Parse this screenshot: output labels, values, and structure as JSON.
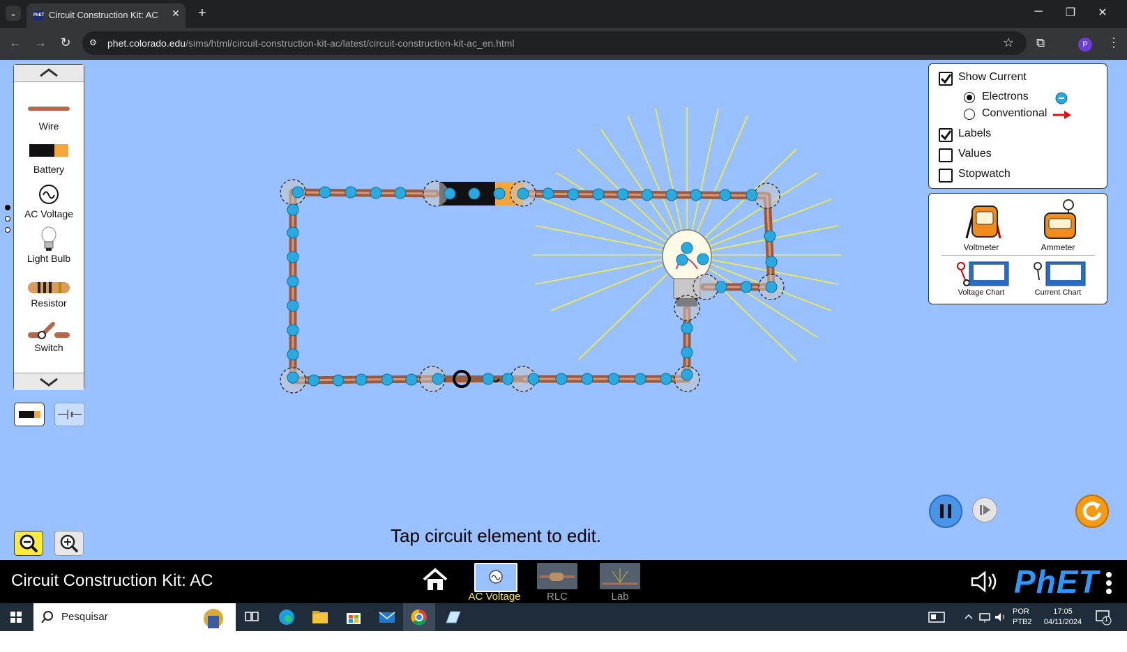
{
  "browser": {
    "tab_title": "Circuit Construction Kit: AC",
    "url_host": "phet.colorado.edu",
    "url_path": "/sims/html/circuit-construction-kit-ac/latest/circuit-construction-kit-ac_en.html"
  },
  "toolbox": {
    "items": [
      {
        "label": "Wire"
      },
      {
        "label": "Battery"
      },
      {
        "label": "AC Voltage"
      },
      {
        "label": "Light Bulb"
      },
      {
        "label": "Resistor"
      },
      {
        "label": "Switch"
      }
    ]
  },
  "status_message": "Tap circuit element to edit.",
  "options": {
    "show_current": {
      "label": "Show Current",
      "checked": true
    },
    "electrons": {
      "label": "Electrons",
      "selected": true
    },
    "conventional": {
      "label": "Conventional",
      "selected": false
    },
    "labels": {
      "label": "Labels",
      "checked": true
    },
    "values": {
      "label": "Values",
      "checked": false
    },
    "stopwatch": {
      "label": "Stopwatch",
      "checked": false
    }
  },
  "sensors": {
    "voltmeter": "Voltmeter",
    "ammeter": "Ammeter",
    "voltage_chart": "Voltage Chart",
    "current_chart": "Current Chart"
  },
  "navbar": {
    "sim_title": "Circuit Construction Kit: AC",
    "screens": [
      {
        "label": "AC Voltage",
        "selected": true
      },
      {
        "label": "RLC",
        "selected": false
      },
      {
        "label": "Lab",
        "selected": false
      }
    ],
    "logo": "PhET"
  },
  "taskbar": {
    "search_placeholder": "Pesquisar",
    "lang_line1": "POR",
    "lang_line2": "PTB2",
    "time": "17:05",
    "date": "04/11/2024",
    "notification_count": "1"
  },
  "colors": {
    "sim_background": "#99c1ff",
    "accent_yellow": "#ffeb3b",
    "selected_screen": "#ffeb3b",
    "electron": "#2aa8e0",
    "wire": "#c08060"
  }
}
